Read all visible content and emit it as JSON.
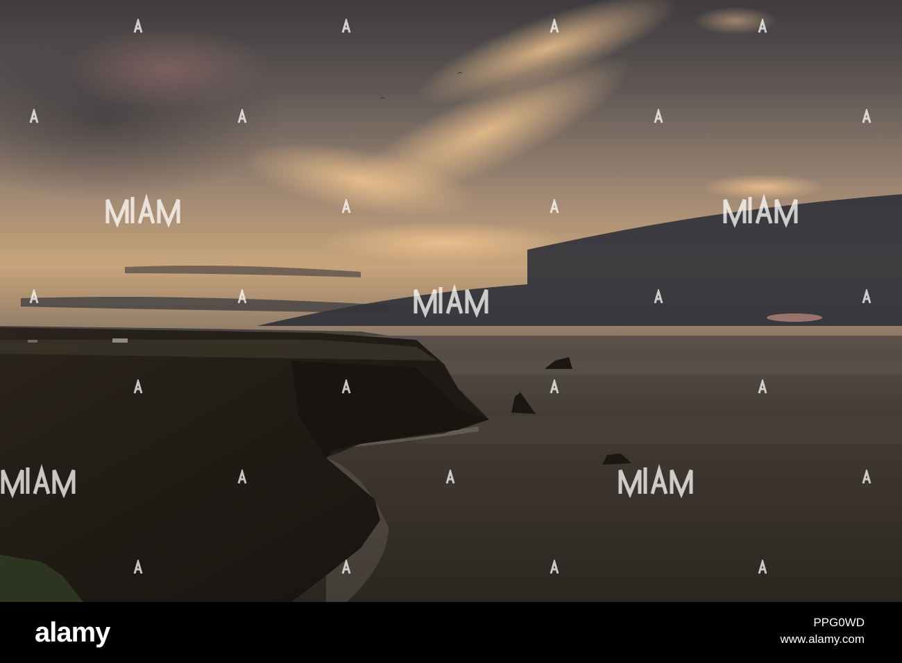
{
  "brand": {
    "logo_text": "alamy"
  },
  "image_info": {
    "id": "PPG0WD",
    "url": "www.alamy.com"
  },
  "colors": {
    "sky_top": "#4a4647",
    "sky_horizon": "#c8a47a",
    "sea": "#2f2b25",
    "cliff": "#1e1a15",
    "cloud_glow": "#e2b684",
    "dark_cloud": "#2e3037"
  }
}
